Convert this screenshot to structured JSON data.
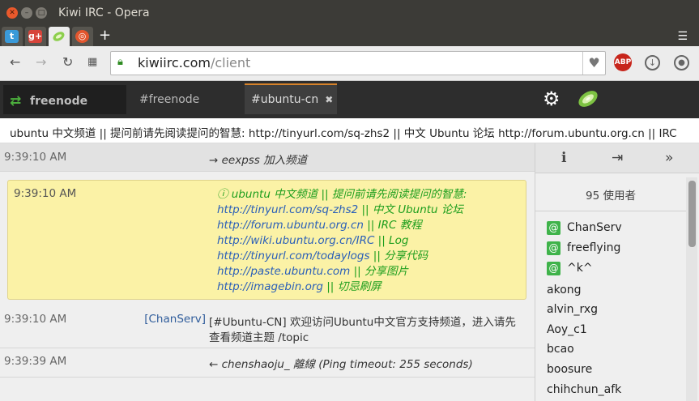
{
  "window": {
    "title": "Kiwi IRC - Opera"
  },
  "browser_tabs": [
    {
      "name": "twitter",
      "glyph": "t",
      "color": "#3a9ad9"
    },
    {
      "name": "google-plus",
      "glyph": "g+",
      "color": "#d7443a"
    },
    {
      "name": "kiwi",
      "glyph": "",
      "color": "#8ccf4d"
    },
    {
      "name": "ubuntu",
      "glyph": "◎",
      "color": "#e2562e"
    }
  ],
  "new_tab_label": "+",
  "toolbar": {
    "url_host": "kiwiirc.com",
    "url_path": "/client",
    "abp_label": "ABP"
  },
  "kiwi": {
    "network": "freenode",
    "channels": [
      {
        "label": "#freenode",
        "active": false
      },
      {
        "label": "#ubuntu-cn",
        "active": true
      }
    ],
    "close_glyph": "✖"
  },
  "topic_bar": "ubuntu 中文频道 || 提问前请先阅读提问的智慧: http://tinyurl.com/sq-zhs2 || 中文 Ubuntu 论坛 http://forum.ubuntu.org.cn || IRC",
  "messages": {
    "join": {
      "time": "9:39:10 AM",
      "text": "→ eexpss 加入频道"
    },
    "topic": {
      "time": "9:39:10 AM",
      "header": "ⓘ ubuntu 中文频道 || 提问前请先阅读提问的智慧:",
      "lines": [
        {
          "url": "http://tinyurl.com/sq-zhs2",
          "text": " || 中文 Ubuntu 论坛"
        },
        {
          "url": "http://forum.ubuntu.org.cn",
          "text": " || IRC 教程"
        },
        {
          "url": "http://wiki.ubuntu.org.cn/IRC",
          "text": " || Log"
        },
        {
          "url": "http://tinyurl.com/todaylogs",
          "text": " || 分享代码"
        },
        {
          "url": "http://paste.ubuntu.com",
          "text": " || 分享图片"
        },
        {
          "url": "http://imagebin.org",
          "text": " || 切忌刷屏"
        }
      ]
    },
    "chanserv": {
      "time": "9:39:10 AM",
      "nick": "[ChanServ]",
      "line1": "[#Ubuntu-CN] 欢迎访问Ubuntu中文官方支持频道，进入请先",
      "line2": "查看频道主题 /topic"
    },
    "quit": {
      "time": "9:39:39 AM",
      "text": "← chenshaoju_ 離線 (Ping timeout: 255 seconds)"
    }
  },
  "sidebar": {
    "user_count": "95 使用者",
    "ops": [
      "ChanServ",
      "freeflying",
      "^k^"
    ],
    "users": [
      "akong",
      "alvin_rxg",
      "Aoy_c1",
      "bcao",
      "boosure",
      "chihchun_afk"
    ],
    "op_glyph": "@"
  }
}
